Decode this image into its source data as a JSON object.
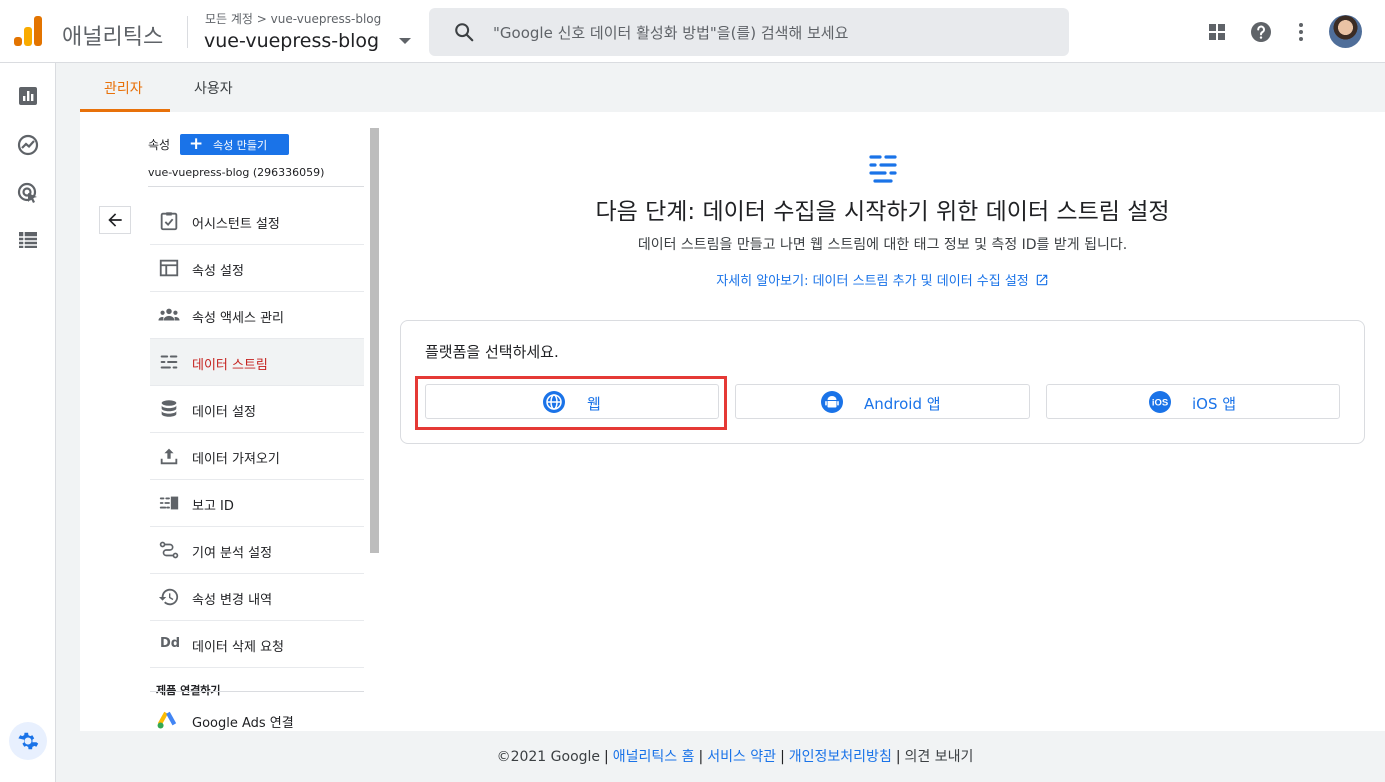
{
  "header": {
    "app_name": "애널리틱스",
    "breadcrumb": "모든 계정 > vue-vuepress-blog",
    "account_name": "vue-vuepress-blog",
    "search_placeholder": "\"Google 신호 데이터 활성화 방법\"을(를) 검색해 보세요",
    "icons": [
      "apps-icon",
      "help-icon",
      "more-vert-icon",
      "avatar"
    ]
  },
  "leftnav": {
    "icons": [
      "reports-icon",
      "explore-icon",
      "advertising-icon",
      "configure-icon",
      "settings-icon"
    ]
  },
  "tabs": [
    {
      "label": "관리자",
      "active": true
    },
    {
      "label": "사용자",
      "active": false
    }
  ],
  "property": {
    "label": "속성",
    "create_button": "속성 만들기",
    "id_text": "vue-vuepress-blog (296336059)"
  },
  "menu": [
    {
      "label": "어시스턴트 설정",
      "icon": "assistant-icon"
    },
    {
      "label": "속성 설정",
      "icon": "property-settings-icon"
    },
    {
      "label": "속성 액세스 관리",
      "icon": "people-icon"
    },
    {
      "label": "데이터 스트림",
      "icon": "data-streams-icon",
      "active": true
    },
    {
      "label": "데이터 설정",
      "icon": "database-icon"
    },
    {
      "label": "데이터 가져오기",
      "icon": "upload-icon"
    },
    {
      "label": "보고 ID",
      "icon": "reporting-id-icon"
    },
    {
      "label": "기여 분석 설정",
      "icon": "attribution-icon"
    },
    {
      "label": "속성 변경 내역",
      "icon": "history-icon"
    },
    {
      "label": "데이터 삭제 요청",
      "icon": "data-deletion-icon"
    }
  ],
  "product_links": {
    "section_label": "제품 연결하기",
    "items": [
      {
        "label": "Google Ads 연결",
        "icon": "google-ads-icon"
      }
    ]
  },
  "main": {
    "title": "다음 단계: 데이터 수집을 시작하기 위한 데이터 스트림 설정",
    "subtitle": "데이터 스트림을 만들고 나면 웹 스트림에 대한 태그 정보 및 측정 ID를 받게 됩니다.",
    "learn_more": "자세히 알아보기: 데이터 스트림 추가 및 데이터 수집 설정",
    "platform_prompt": "플랫폼을 선택하세요.",
    "platforms": [
      {
        "label": "웹",
        "icon": "globe-icon"
      },
      {
        "label": "Android 앱",
        "icon": "android-icon"
      },
      {
        "label": "iOS 앱",
        "icon": "ios-icon"
      }
    ]
  },
  "footer": {
    "copyright": "©2021 Google",
    "links": [
      "애널리틱스 홈",
      "서비스 약관",
      "개인정보처리방침"
    ],
    "feedback": "의견 보내기"
  },
  "colors": {
    "accent_blue": "#1a73e8",
    "active_tab": "#e8710a",
    "active_menu_text": "#c5221f",
    "highlight_border": "#e53935"
  }
}
